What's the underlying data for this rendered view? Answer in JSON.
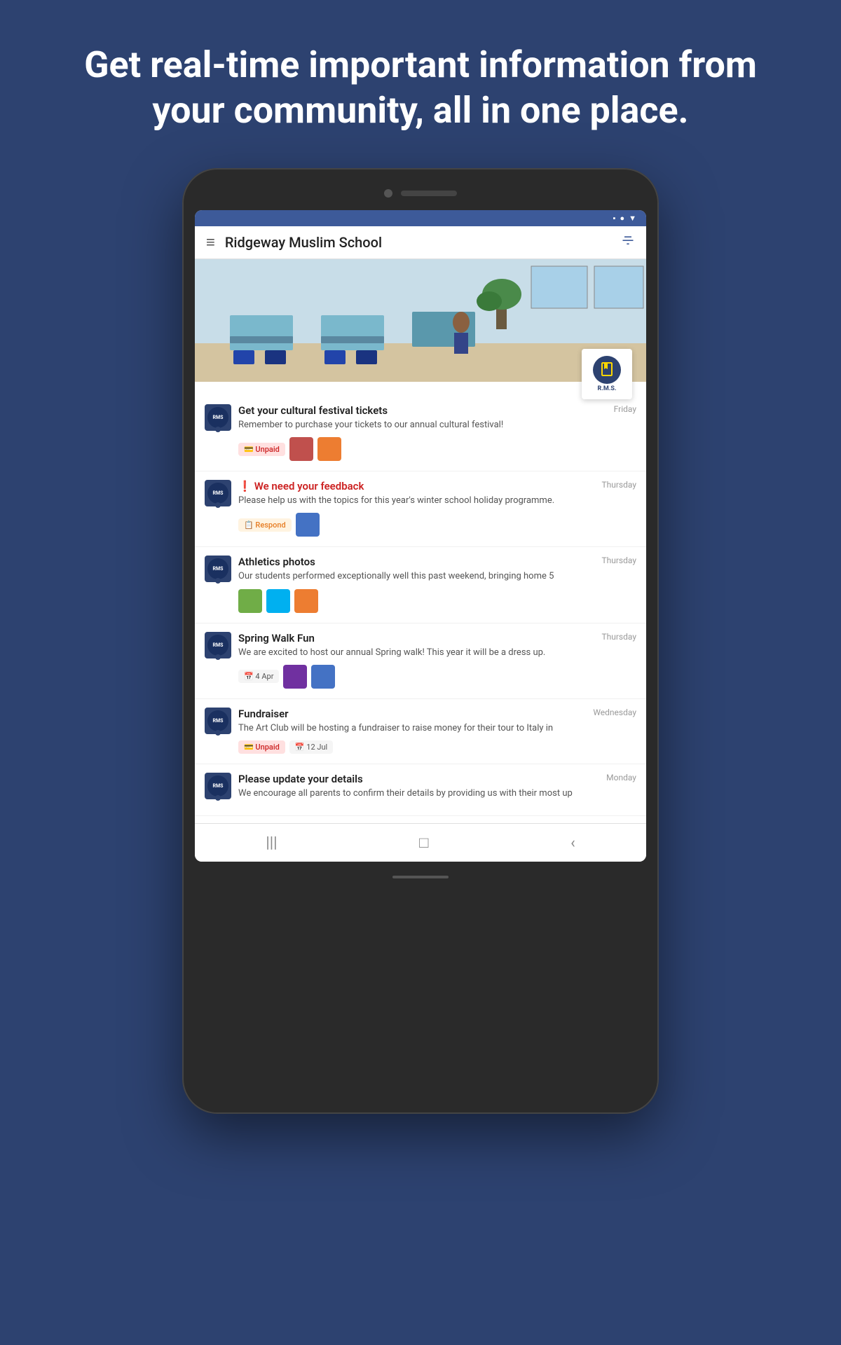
{
  "hero": {
    "text": "Get real-time important information from your community, all in one place."
  },
  "statusBar": {
    "icons": [
      "▪",
      "●",
      "▼"
    ]
  },
  "appBar": {
    "title": "Ridgeway Muslim School",
    "menuIcon": "≡",
    "filterIcon": "⊘"
  },
  "logo": {
    "line1": "R.M.S.",
    "emblem": "RMS"
  },
  "feedItems": [
    {
      "id": "item-1",
      "title": "Get your cultural festival tickets",
      "date": "Friday",
      "body": "Remember to purchase your tickets to our annual cultural festival!",
      "urgent": false,
      "tags": [
        {
          "type": "unpaid",
          "label": "Unpaid"
        }
      ],
      "thumbs": [
        "red",
        "orange"
      ]
    },
    {
      "id": "item-2",
      "title": "We need your feedback",
      "date": "Thursday",
      "body": "Please help us with the topics for this year's winter school holiday programme.",
      "urgent": true,
      "tags": [
        {
          "type": "respond",
          "label": "Respond"
        }
      ],
      "thumbs": [
        "blue"
      ]
    },
    {
      "id": "item-3",
      "title": "Athletics photos",
      "date": "Thursday",
      "body": "Our students performed exceptionally well this past weekend, bringing home 5",
      "urgent": false,
      "tags": [],
      "thumbs": [
        "green",
        "teal",
        "orange"
      ]
    },
    {
      "id": "item-4",
      "title": "Spring Walk Fun",
      "date": "Thursday",
      "body": "We are excited to host our annual Spring walk!  This year it will be a dress up.",
      "urgent": false,
      "tags": [
        {
          "type": "date",
          "label": "4 Apr"
        }
      ],
      "thumbs": [
        "purple",
        "blue"
      ]
    },
    {
      "id": "item-5",
      "title": "Fundraiser",
      "date": "Wednesday",
      "body": "The Art Club will be hosting a fundraiser to raise money for their tour to Italy in",
      "urgent": false,
      "tags": [
        {
          "type": "unpaid",
          "label": "Unpaid"
        },
        {
          "type": "date",
          "label": "12 Jul"
        }
      ],
      "thumbs": []
    },
    {
      "id": "item-6",
      "title": "Please update your details",
      "date": "Monday",
      "body": "We encourage all parents to confirm their details by providing us with their most up",
      "urgent": false,
      "tags": [],
      "thumbs": []
    }
  ],
  "bottomNav": {
    "icons": [
      "|||",
      "□",
      "<"
    ]
  }
}
